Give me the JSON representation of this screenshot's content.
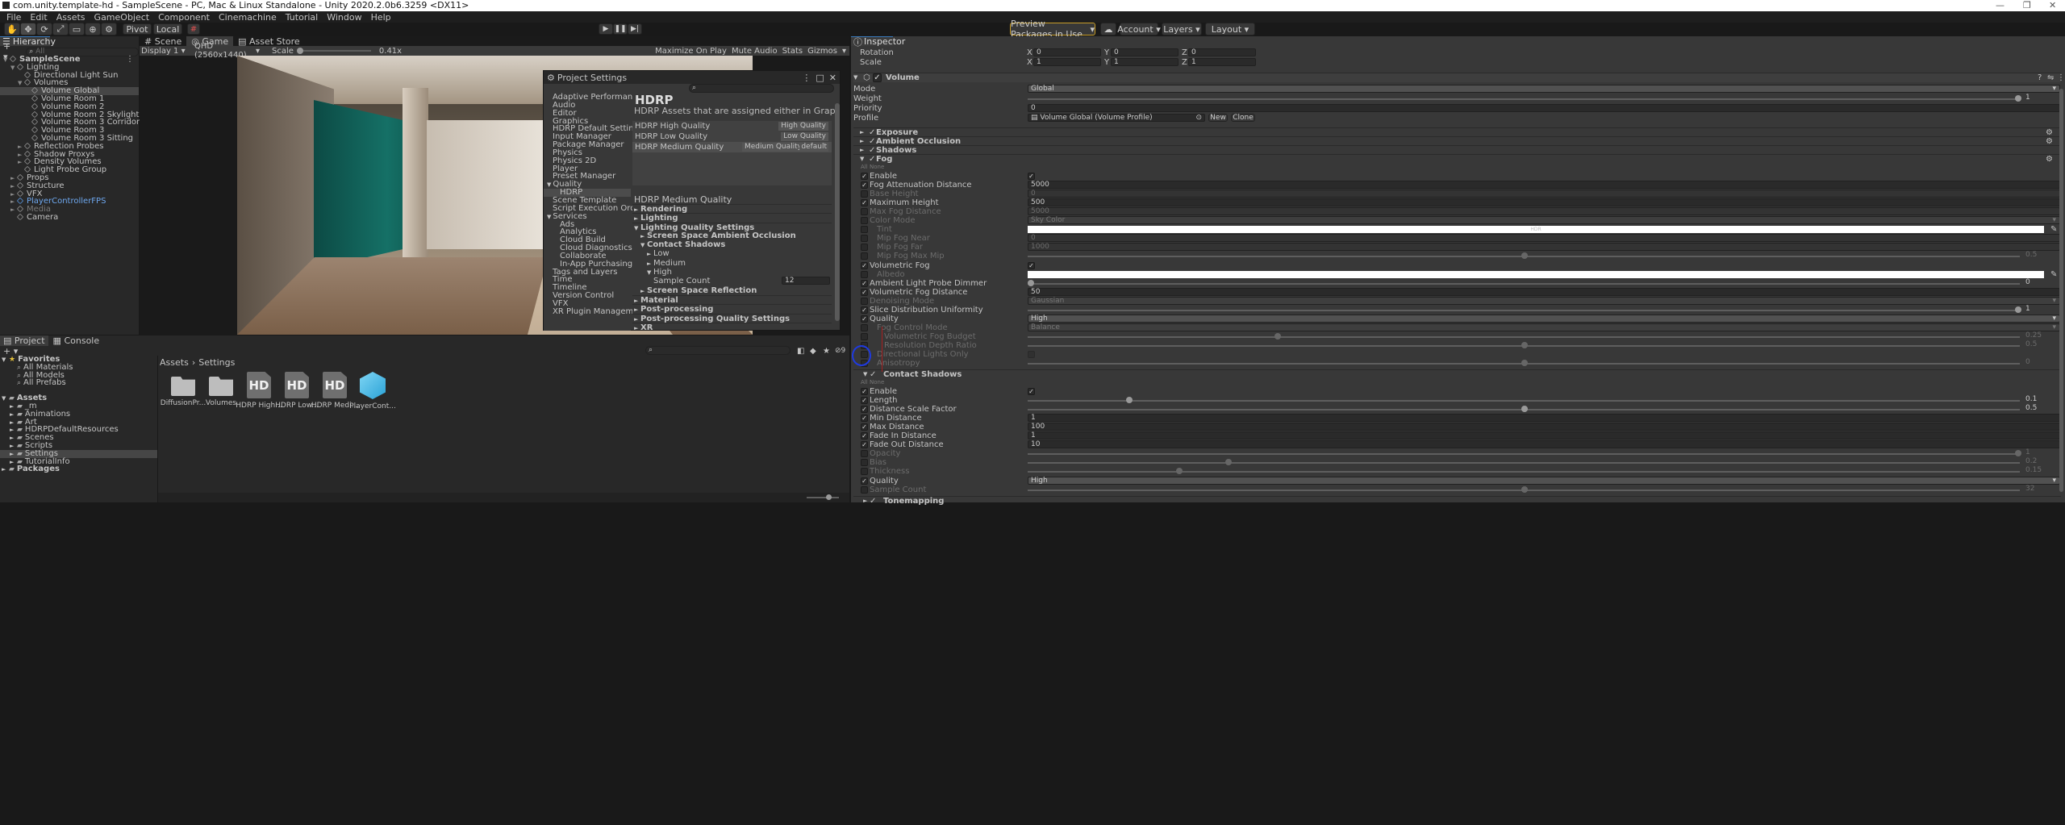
{
  "title_bar": {
    "title": "com.unity.template-hd - SampleScene - PC, Mac & Linux Standalone - Unity 2020.2.0b6.3259 <DX11>",
    "min": "—",
    "max": "❐",
    "close": "✕"
  },
  "menu": [
    "File",
    "Edit",
    "Assets",
    "GameObject",
    "Component",
    "Cinemachine",
    "Tutorial",
    "Window",
    "Help"
  ],
  "toolbar": {
    "pivot": "Pivot",
    "local": "Local",
    "preview": "Preview Packages in Use",
    "account": "Account",
    "layers": "Layers",
    "layout": "Layout"
  },
  "hierarchy": {
    "tab": "Hierarchy",
    "search_placeholder": "All",
    "items": [
      {
        "label": "SampleScene",
        "indent": 0,
        "arrow": "▼",
        "bold": true,
        "scene": true
      },
      {
        "label": "Lighting",
        "indent": 1,
        "arrow": "▼"
      },
      {
        "label": "Directional Light Sun",
        "indent": 2,
        "arrow": ""
      },
      {
        "label": "Volumes",
        "indent": 2,
        "arrow": "▼"
      },
      {
        "label": "Volume Global",
        "indent": 3,
        "arrow": "",
        "selected": true
      },
      {
        "label": "Volume Room 1",
        "indent": 3,
        "arrow": ""
      },
      {
        "label": "Volume Room 2",
        "indent": 3,
        "arrow": ""
      },
      {
        "label": "Volume Room 2 Skylight",
        "indent": 3,
        "arrow": ""
      },
      {
        "label": "Volume Room 3 Corridor",
        "indent": 3,
        "arrow": ""
      },
      {
        "label": "Volume Room 3",
        "indent": 3,
        "arrow": ""
      },
      {
        "label": "Volume Room 3 Sitting",
        "indent": 3,
        "arrow": ""
      },
      {
        "label": "Reflection Probes",
        "indent": 2,
        "arrow": "►"
      },
      {
        "label": "Shadow Proxys",
        "indent": 2,
        "arrow": "►"
      },
      {
        "label": "Density Volumes",
        "indent": 2,
        "arrow": "►"
      },
      {
        "label": "Light Probe Group",
        "indent": 2,
        "arrow": ""
      },
      {
        "label": "Props",
        "indent": 1,
        "arrow": "►"
      },
      {
        "label": "Structure",
        "indent": 1,
        "arrow": "►"
      },
      {
        "label": "VFX",
        "indent": 1,
        "arrow": "►"
      },
      {
        "label": "PlayerControllerFPS",
        "indent": 1,
        "arrow": "►",
        "prefab": true
      },
      {
        "label": "Media",
        "indent": 1,
        "arrow": "►",
        "dim": true
      },
      {
        "label": "Camera",
        "indent": 1,
        "arrow": ""
      }
    ]
  },
  "game": {
    "tabs": [
      "Scene",
      "Game",
      "Asset Store"
    ],
    "display": "Display 1",
    "resolution": "QHD (2560x1440)",
    "scale_label": "Scale",
    "scale_value": "0.41x",
    "maximize": "Maximize On Play",
    "mute": "Mute Audio",
    "stats": "Stats",
    "gizmos": "Gizmos"
  },
  "project_settings": {
    "title": "Project Settings",
    "header": "HDRP",
    "subtitle": "HDRP Assets that are assigned either in Graphics settings or in",
    "nav": [
      {
        "label": "Adaptive Performance",
        "indent": 0
      },
      {
        "label": "Audio",
        "indent": 0
      },
      {
        "label": "Editor",
        "indent": 0
      },
      {
        "label": "Graphics",
        "indent": 0
      },
      {
        "label": "HDRP Default Settings",
        "indent": 0
      },
      {
        "label": "Input Manager",
        "indent": 0
      },
      {
        "label": "Package Manager",
        "indent": 0
      },
      {
        "label": "Physics",
        "indent": 0
      },
      {
        "label": "Physics 2D",
        "indent": 0
      },
      {
        "label": "Player",
        "indent": 0
      },
      {
        "label": "Preset Manager",
        "indent": 0
      },
      {
        "label": "Quality",
        "indent": 0,
        "arrow": "▼"
      },
      {
        "label": "HDRP",
        "indent": 1,
        "selected": true
      },
      {
        "label": "Scene Template",
        "indent": 0
      },
      {
        "label": "Script Execution Order",
        "indent": 0
      },
      {
        "label": "Services",
        "indent": 0,
        "arrow": "▼"
      },
      {
        "label": "Ads",
        "indent": 1
      },
      {
        "label": "Analytics",
        "indent": 1
      },
      {
        "label": "Cloud Build",
        "indent": 1
      },
      {
        "label": "Cloud Diagnostics",
        "indent": 1
      },
      {
        "label": "Collaborate",
        "indent": 1
      },
      {
        "label": "In-App Purchasing",
        "indent": 1
      },
      {
        "label": "Tags and Layers",
        "indent": 0
      },
      {
        "label": "Time",
        "indent": 0
      },
      {
        "label": "Timeline",
        "indent": 0
      },
      {
        "label": "Version Control",
        "indent": 0
      },
      {
        "label": "VFX",
        "indent": 0
      },
      {
        "label": "XR Plugin Management",
        "indent": 0
      }
    ],
    "assets": [
      {
        "name": "HDRP High Quality",
        "tag": "High Quality"
      },
      {
        "name": "HDRP Low Quality",
        "tag": "Low Quality"
      },
      {
        "name": "HDRP Medium Quality",
        "tag": "Medium Quality",
        "extra": "default"
      }
    ],
    "section_title": "HDRP Medium Quality",
    "tree": [
      {
        "label": "Rendering",
        "indent": 0,
        "arrow": "►",
        "bold": true
      },
      {
        "label": "Lighting",
        "indent": 0,
        "arrow": "►",
        "bold": true
      },
      {
        "label": "Lighting Quality Settings",
        "indent": 0,
        "arrow": "▼",
        "bold": true
      },
      {
        "label": "Screen Space Ambient Occlusion",
        "indent": 1,
        "arrow": "►",
        "bold": true
      },
      {
        "label": "Contact Shadows",
        "indent": 1,
        "arrow": "▼",
        "bold": true
      },
      {
        "label": "Low",
        "indent": 2,
        "arrow": "►"
      },
      {
        "label": "Medium",
        "indent": 2,
        "arrow": "►"
      },
      {
        "label": "High",
        "indent": 2,
        "arrow": "▼"
      },
      {
        "label": "Sample Count",
        "indent": 2,
        "arrow": "",
        "value": "12"
      },
      {
        "label": "Screen Space Reflection",
        "indent": 1,
        "arrow": "►",
        "bold": true
      },
      {
        "label": "Material",
        "indent": 0,
        "arrow": "►",
        "bold": true
      },
      {
        "label": "Post-processing",
        "indent": 0,
        "arrow": "►",
        "bold": true
      },
      {
        "label": "Post-processing Quality Settings",
        "indent": 0,
        "arrow": "►",
        "bold": true
      },
      {
        "label": "XR",
        "indent": 0,
        "arrow": "►",
        "bold": true
      }
    ]
  },
  "project": {
    "tabs": [
      "Project",
      "Console"
    ],
    "breadcrumb": [
      "Assets",
      "Settings"
    ],
    "favorites": "Favorites",
    "fav_items": [
      "All Materials",
      "All Models",
      "All Prefabs"
    ],
    "assets_label": "Assets",
    "asset_folders": [
      "_m",
      "Animations",
      "Art",
      "HDRPDefaultResources",
      "Scenes",
      "Scripts",
      "Settings",
      "TutorialInfo"
    ],
    "packages": "Packages",
    "files": [
      {
        "name": "DiffusionPr...",
        "kind": "folder"
      },
      {
        "name": "Volumes",
        "kind": "folder"
      },
      {
        "name": "HDRP High...",
        "kind": "hd"
      },
      {
        "name": "HDRP Low...",
        "kind": "hd"
      },
      {
        "name": "HDRP Medi...",
        "kind": "hd"
      },
      {
        "name": "PlayerCont...",
        "kind": "prefab"
      }
    ],
    "hd_text": "HD",
    "count": "9"
  },
  "inspector": {
    "tab": "Inspector",
    "transform": [
      {
        "label": "Rotation",
        "x": "0",
        "y": "0",
        "z": "0"
      },
      {
        "label": "Scale",
        "x": "1",
        "y": "1",
        "z": "1"
      }
    ],
    "axis": [
      "X",
      "Y",
      "Z"
    ],
    "component": "Volume",
    "mode_label": "Mode",
    "mode": "Global",
    "weight_label": "Weight",
    "weight": "1",
    "weight_frac": 1.0,
    "priority_label": "Priority",
    "priority": "0",
    "profile_label": "Profile",
    "profile": "Volume Global (Volume Profile)",
    "new": "New",
    "clone": "Clone",
    "overrides": [
      "Exposure",
      "Ambient Occlusion",
      "Shadows",
      "Fog"
    ],
    "all": "All",
    "none": "None",
    "fog_rows": [
      {
        "label": "Enable",
        "ovr": true,
        "type": "check",
        "value": "✓"
      },
      {
        "label": "Fog Attenuation Distance",
        "ovr": true,
        "type": "text",
        "value": "5000"
      },
      {
        "label": "Base Height",
        "ovr": false,
        "type": "text",
        "value": "0",
        "dim": true
      },
      {
        "label": "Maximum Height",
        "ovr": true,
        "type": "text",
        "value": "500"
      },
      {
        "label": "Max Fog Distance",
        "ovr": false,
        "type": "text",
        "value": "5000",
        "dim": true
      },
      {
        "label": "Color Mode",
        "ovr": false,
        "type": "enum",
        "value": "Sky Color",
        "dim": true
      },
      {
        "label": "Tint",
        "ovr": false,
        "type": "color",
        "value": "HDR",
        "dim": true,
        "indent": 1
      },
      {
        "label": "Mip Fog Near",
        "ovr": false,
        "type": "text",
        "value": "0",
        "dim": true,
        "indent": 1
      },
      {
        "label": "Mip Fog Far",
        "ovr": false,
        "type": "text",
        "value": "1000",
        "dim": true,
        "indent": 1
      },
      {
        "label": "Mip Fog Max Mip",
        "ovr": false,
        "type": "slider",
        "value": "0.5",
        "frac": 0.5,
        "dim": true,
        "indent": 1
      },
      {
        "label": "Volumetric Fog",
        "ovr": true,
        "type": "check",
        "value": "✓"
      },
      {
        "label": "Albedo",
        "ovr": false,
        "type": "color",
        "value": "",
        "dim": true,
        "indent": 1
      },
      {
        "label": "Ambient Light Probe Dimmer",
        "ovr": true,
        "type": "slider",
        "value": "0",
        "frac": 0.0
      },
      {
        "label": "Volumetric Fog Distance",
        "ovr": true,
        "type": "text",
        "value": "50"
      },
      {
        "label": "Denoising Mode",
        "ovr": false,
        "type": "enum",
        "value": "Gaussian",
        "dim": true
      },
      {
        "label": "Slice Distribution Uniformity",
        "ovr": true,
        "type": "slider",
        "value": "1",
        "frac": 1.0
      },
      {
        "label": "Quality",
        "ovr": true,
        "type": "enum",
        "value": "High"
      },
      {
        "label": "Fog Control Mode",
        "ovr": false,
        "type": "enum",
        "value": "Balance",
        "dim": true,
        "indent": 1
      },
      {
        "label": "Volumetric Fog Budget",
        "ovr": false,
        "type": "slider",
        "value": "0.25",
        "frac": 0.25,
        "dim": true,
        "indent": 2
      },
      {
        "label": "Resolution Depth Ratio",
        "ovr": false,
        "type": "slider",
        "value": "0.5",
        "frac": 0.5,
        "dim": true,
        "indent": 2
      },
      {
        "label": "Directional Lights Only",
        "ovr": false,
        "type": "check",
        "value": "",
        "dim": true,
        "indent": 1
      },
      {
        "label": "Anisotropy",
        "ovr": false,
        "type": "slider",
        "value": "0",
        "frac": 0.5,
        "dim": true,
        "indent": 1
      }
    ],
    "contact_shadows": "Contact Shadows",
    "cs_rows": [
      {
        "label": "Enable",
        "ovr": true,
        "type": "check",
        "value": "✓"
      },
      {
        "label": "Length",
        "ovr": true,
        "type": "slider",
        "value": "0.1",
        "frac": 0.1
      },
      {
        "label": "Distance Scale Factor",
        "ovr": true,
        "type": "slider",
        "value": "0.5",
        "frac": 0.5
      },
      {
        "label": "Min Distance",
        "ovr": true,
        "type": "text",
        "value": "1"
      },
      {
        "label": "Max Distance",
        "ovr": true,
        "type": "text",
        "value": "100"
      },
      {
        "label": "Fade In Distance",
        "ovr": true,
        "type": "text",
        "value": "1"
      },
      {
        "label": "Fade Out Distance",
        "ovr": true,
        "type": "text",
        "value": "10"
      },
      {
        "label": "Opacity",
        "ovr": false,
        "type": "slider",
        "value": "1",
        "frac": 1.0,
        "dim": true
      },
      {
        "label": "Bias",
        "ovr": false,
        "type": "slider",
        "value": "0.2",
        "frac": 0.2,
        "dim": true
      },
      {
        "label": "Thickness",
        "ovr": false,
        "type": "slider",
        "value": "0.15",
        "frac": 0.15,
        "dim": true
      },
      {
        "label": "Quality",
        "ovr": true,
        "type": "enum",
        "value": "High"
      },
      {
        "label": "Sample Count",
        "ovr": false,
        "type": "slider",
        "value": "32",
        "frac": 0.5,
        "dim": true
      }
    ],
    "tonemapping": "Tonemapping"
  }
}
